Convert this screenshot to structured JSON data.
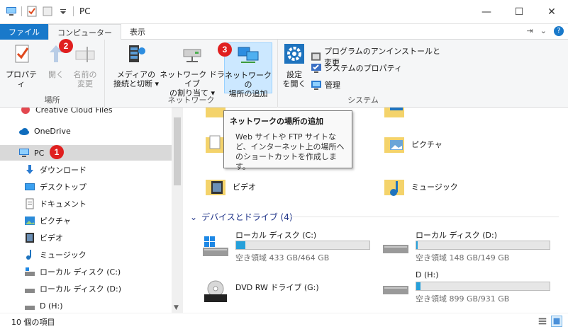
{
  "window": {
    "title": "PC",
    "minimize": "—",
    "maximize": "☐",
    "close": "✕"
  },
  "tabs": {
    "file": "ファイル",
    "computer": "コンピューター",
    "view": "表示",
    "help": "?"
  },
  "ribbon": {
    "location": {
      "label": "場所",
      "properties": "プロパティ",
      "open": "開く",
      "rename_1": "名前の",
      "rename_2": "変更"
    },
    "network": {
      "label": "ネットワーク",
      "media_1": "メディアの",
      "media_2": "接続と切断",
      "map_1": "ネットワーク ドライブ",
      "map_2": "の割り当て",
      "add_1": "ネットワークの",
      "add_2": "場所の追加"
    },
    "system": {
      "label": "システム",
      "settings_1": "設定",
      "settings_2": "を開く",
      "uninstall": "プログラムのアンインストールと変更",
      "sys_props": "システムのプロパティ",
      "manage": "管理"
    }
  },
  "badges": {
    "one": "1",
    "two": "2",
    "three": "3"
  },
  "nav": {
    "creative_cloud": "Creative Cloud Files",
    "onedrive": "OneDrive",
    "pc": "PC",
    "downloads": "ダウンロード",
    "desktop": "デスクトップ",
    "documents": "ドキュメント",
    "pictures": "ピクチャ",
    "videos": "ビデオ",
    "music": "ミュージック",
    "local_c": "ローカル ディスク (C:)",
    "local_d": "ローカル ディスク (D:)",
    "drive_h": "D (H:)"
  },
  "folders": {
    "pictures": "ピクチャ",
    "videos": "ビデオ",
    "music": "ミュージック"
  },
  "devices": {
    "header": "デバイスとドライブ (4)",
    "drives": [
      {
        "name": "ローカル ディスク (C:)",
        "free": "空き領域 433 GB/464 GB",
        "used_pct": 7
      },
      {
        "name": "ローカル ディスク (D:)",
        "free": "空き領域 148 GB/149 GB",
        "used_pct": 1
      },
      {
        "name": "DVD RW ドライブ (G:)",
        "free": "",
        "used_pct": 0
      },
      {
        "name": "D (H:)",
        "free": "空き領域 899 GB/931 GB",
        "used_pct": 3
      }
    ]
  },
  "tooltip": {
    "title": "ネットワークの場所の追加",
    "desc": "Web サイトや FTP サイトなど、インターネット上の場所へのショートカットを作成します。"
  },
  "status": {
    "items": "10 個の項目"
  },
  "colors": {
    "accent": "#1979ca",
    "badge": "#e01f1f",
    "bar": "#26a0da"
  }
}
